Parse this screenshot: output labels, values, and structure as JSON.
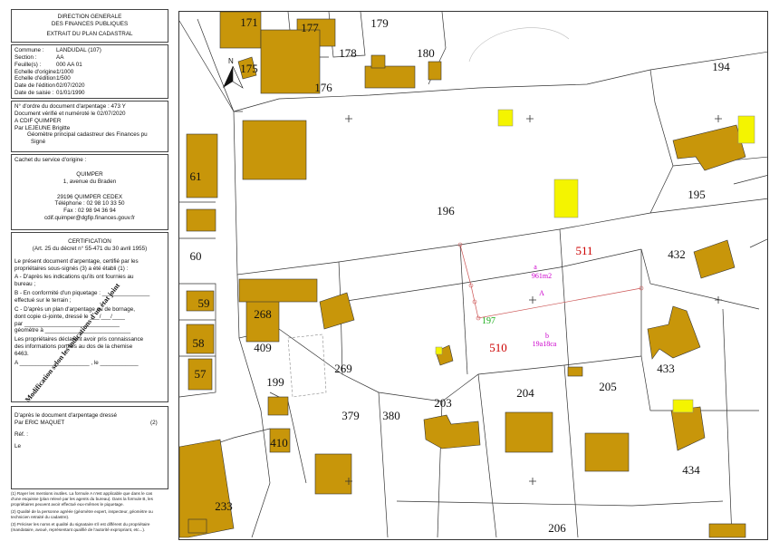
{
  "header": {
    "line1": "DIRECTION GENERALE",
    "line2": "DES FINANCES PUBLIQUES",
    "line3": "EXTRAIT DU PLAN CADASTRAL"
  },
  "info": {
    "commune_label": "Commune :",
    "commune_value": "LANDUDAL (107)",
    "section_label": "Section :",
    "section_value": "AA",
    "feuille_label": "Feuille(s) :",
    "feuille_value": "000 AA 01",
    "echelle_origine_label": "Echelle d'origine :",
    "echelle_origine_value": "1/1000",
    "echelle_edition_label": "Echelle d'édition :",
    "echelle_edition_value": "1/500",
    "date_edition_label": "Date de l'édition :",
    "date_edition_value": "02/07/2020",
    "date_saisie_label": "Date de saisie :",
    "date_saisie_value": "01/01/1990"
  },
  "arpentage": {
    "l1": "N° d'ordre du document d'arpentage : 473 Y",
    "l2": "Document vérifié et numéroté le 02/07/2020",
    "l3": "A CDIF QUIMPER",
    "l4": "Par LEJEUNE Brigitte",
    "l5": "Géomètre principal  cadastreur des Finances pu",
    "l6": "Signé"
  },
  "cachet": {
    "title": "Cachet du service d'origine :",
    "l1": "QUIMPER",
    "l2": "1, avenue du Braden",
    "l3": "29196 QUIMPER CEDEX",
    "l4": "Téléphone : 02 98 10 33 50",
    "l5": "Fax : 02 98 94 36 94",
    "l6": "cdif.quimper@dgfip.finances.gouv.fr"
  },
  "certification": {
    "title": "CERTIFICATION",
    "subtitle": "(Art. 25 du décret n° 55-471 du 30 avril 1955)",
    "l1": "Le présent document d'arpentage, certifié par les",
    "l2": "propriétaires sous-signés (3) a été établi (1) :",
    "l3": "A - D'après les indications qu'ils ont fournies au",
    "l4": "bureau ;",
    "l5": "B - En conformité d'un piquetage : _______________",
    "l6": "effectué sur le terrain ;",
    "l7": "C - D'après un  plan d'arpentage ou  de bornage,",
    "l8": "dont copie ci-jointe, dressé le ___/___/____",
    "l9": "par ______________________________",
    "l10": "géomètre à ___________________________",
    "l11": "Les propriétaires déclarent avoir pris connaissance",
    "l12": "des informations portées au dos  de la chemise",
    "l13": "6463.",
    "l14": "A ______________________ , le ____________"
  },
  "stamp_text": "Modification selon les indications d'un état joint",
  "dresse": {
    "l1": "D'après le document d'arpentage dressé",
    "l2": "Par   ERIC MAQUET",
    "l2_num": "(2)",
    "l3": "Réf. :",
    "l4": "Le"
  },
  "footnotes": {
    "f1": "(1) Rayer les mentions inutiles. La formule A n'est applicable que dans le  cas",
    "f1b": "d'une esquisse (plan relevé par les agents du bureau). Dans la formule B, les",
    "f1c": "propriétaires peuvent avoir effectué eux-mêmes le piquetage.",
    "f2": "(2) Qualité de la personne agréée (géomètre expert, inspecteur, géomètre ou",
    "f2b": "technicien retraité du cadastre).",
    "f3": "(3) Préciser les noms et qualité du signataire s'il est différent du propriétaire",
    "f3b": "(mandataire, avoué, représentant qualifié de l'autorité expropriant, etc...)."
  },
  "map": {
    "north": "N",
    "parcels": {
      "p171": "171",
      "p177": "177",
      "p179": "179",
      "p175": "175",
      "p178": "178",
      "p180": "180",
      "p176": "176",
      "p194": "194",
      "p61": "61",
      "p196": "196",
      "p195": "195",
      "p60": "60",
      "p511": "511",
      "p432": "432",
      "p59": "59",
      "p268": "268",
      "p197": "197",
      "p58": "58",
      "p409": "409",
      "p510": "510",
      "p433": "433",
      "p269": "269",
      "p57": "57",
      "p199": "199",
      "p203": "203",
      "p204": "204",
      "p205": "205",
      "p379": "379",
      "p380": "380",
      "p410": "410",
      "p434": "434",
      "p233": "233",
      "p206": "206"
    },
    "lot_a_label": "a",
    "lot_a_area": "961m2",
    "lot_A": "A",
    "lot_b_label": "b",
    "lot_b_area": "19a18ca"
  }
}
